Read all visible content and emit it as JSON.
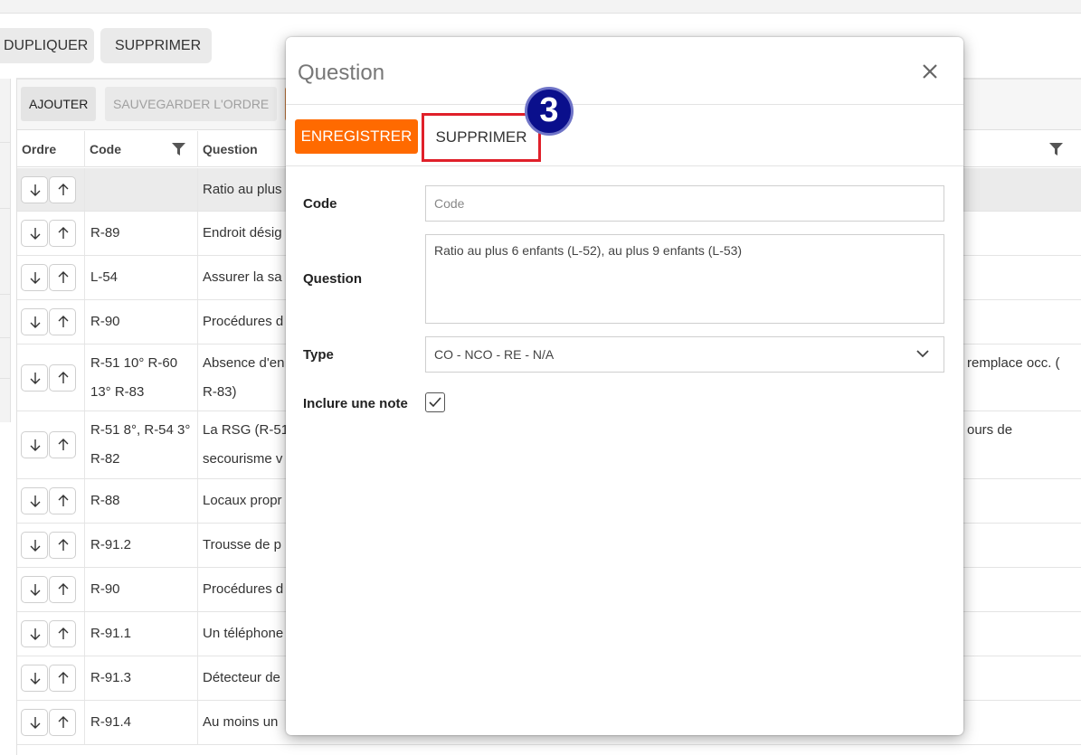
{
  "top_actions": {
    "dupliquer": "DUPLIQUER",
    "supprimer": "SUPPRIMER"
  },
  "toolbar": {
    "ajouter": "AJOUTER",
    "sauvegarder_ordre": "SAUVEGARDER L'ORDRE"
  },
  "columns": {
    "ordre": "Ordre",
    "code": "Code",
    "question": "Question"
  },
  "rows": [
    {
      "code": "",
      "question": "Ratio au plus",
      "right": ""
    },
    {
      "code": "R-89",
      "question": "Endroit désig",
      "right": ""
    },
    {
      "code": "L-54",
      "question": "Assurer la sa",
      "right": ""
    },
    {
      "code": "R-90",
      "question": "Procédures d",
      "right": ""
    },
    {
      "code": "R-51 10° R-60 13° R-83",
      "question": "Absence d'en",
      "question2": "R-83)",
      "right": "remplace occ. ("
    },
    {
      "code": "R-51 8°, R-54 3° R-82",
      "question": "La RSG (R-51",
      "question2": "secourisme v",
      "right": "ours de"
    },
    {
      "code": "R-88",
      "question": "Locaux propr",
      "right": ""
    },
    {
      "code": "R-91.2",
      "question": "Trousse de p",
      "right": ""
    },
    {
      "code": "R-90",
      "question": "Procédures d",
      "right": ""
    },
    {
      "code": "R-91.1",
      "question": "Un téléphone",
      "right": ""
    },
    {
      "code": "R-91.3",
      "question": "Détecteur de",
      "right": ""
    },
    {
      "code": "R-91.4",
      "question": "Au moins un",
      "right": ""
    }
  ],
  "modal": {
    "title": "Question",
    "save_label": "ENREGISTRER",
    "delete_label": "SUPPRIMER",
    "step_badge": "3",
    "code_label": "Code",
    "code_placeholder": "Code",
    "question_label": "Question",
    "question_value": "Ratio au plus 6 enfants (L-52), au plus 9 enfants (L-53)",
    "type_label": "Type",
    "type_value": "CO - NCO - RE - N/A",
    "note_label": "Inclure une note",
    "note_checked": true
  },
  "colors": {
    "accent": "#ff6a00",
    "highlight": "#e0202a",
    "badge": "#0a0f8c"
  }
}
